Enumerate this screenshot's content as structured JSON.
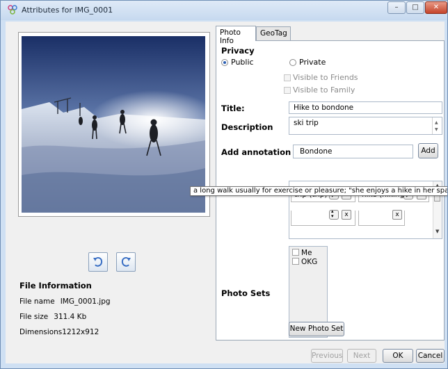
{
  "window": {
    "title": "Attributes for  IMG_0001",
    "controls": {
      "minimize": "–",
      "maximize": "□",
      "close": "✕"
    }
  },
  "left": {
    "photo_alt_icon": "photo-thumbnail",
    "rotate_left_icon": "rotate-left-icon",
    "rotate_right_icon": "rotate-right-icon",
    "file_info": {
      "title": "File Information",
      "rows": [
        {
          "key": "File name",
          "value": "IMG_0001.jpg"
        },
        {
          "key": "File size",
          "value": "311.4 Kb"
        },
        {
          "key": "Dimensions",
          "value": "1212x912"
        }
      ]
    }
  },
  "tabs": [
    {
      "label": "Photo Info"
    },
    {
      "label": "GeoTag"
    }
  ],
  "photo_info": {
    "privacy_title": "Privacy",
    "public_label": "Public",
    "private_label": "Private",
    "visible_friends_label": "Visible to Friends",
    "visible_family_label": "Visible to Family",
    "title_label": "Title:",
    "title_value": "Hike to bondone",
    "description_label": "Description",
    "description_value": "ski trip",
    "annotation_label": "Add annotation",
    "annotation_value": "Bondone",
    "add_button": "Add",
    "annotations": [
      {
        "label": "trip (trip)"
      },
      {
        "label": "hike (hiking)"
      }
    ],
    "tooltip": "a long walk usually for exercise or pleasure; \"she enjoys a hike in her spare time\"",
    "photo_sets_label": "Photo Sets",
    "photo_sets": [
      {
        "label": "Me"
      },
      {
        "label": "OKG"
      }
    ],
    "new_photo_set_button": "New Photo Set"
  },
  "footer": {
    "previous": "Previous",
    "next": "Next",
    "ok": "OK",
    "cancel": "Cancel"
  },
  "colors": {
    "title_bar": "#cfe0f3",
    "close_button": "#c4432a",
    "radio_selected": "#2b5fb3"
  }
}
